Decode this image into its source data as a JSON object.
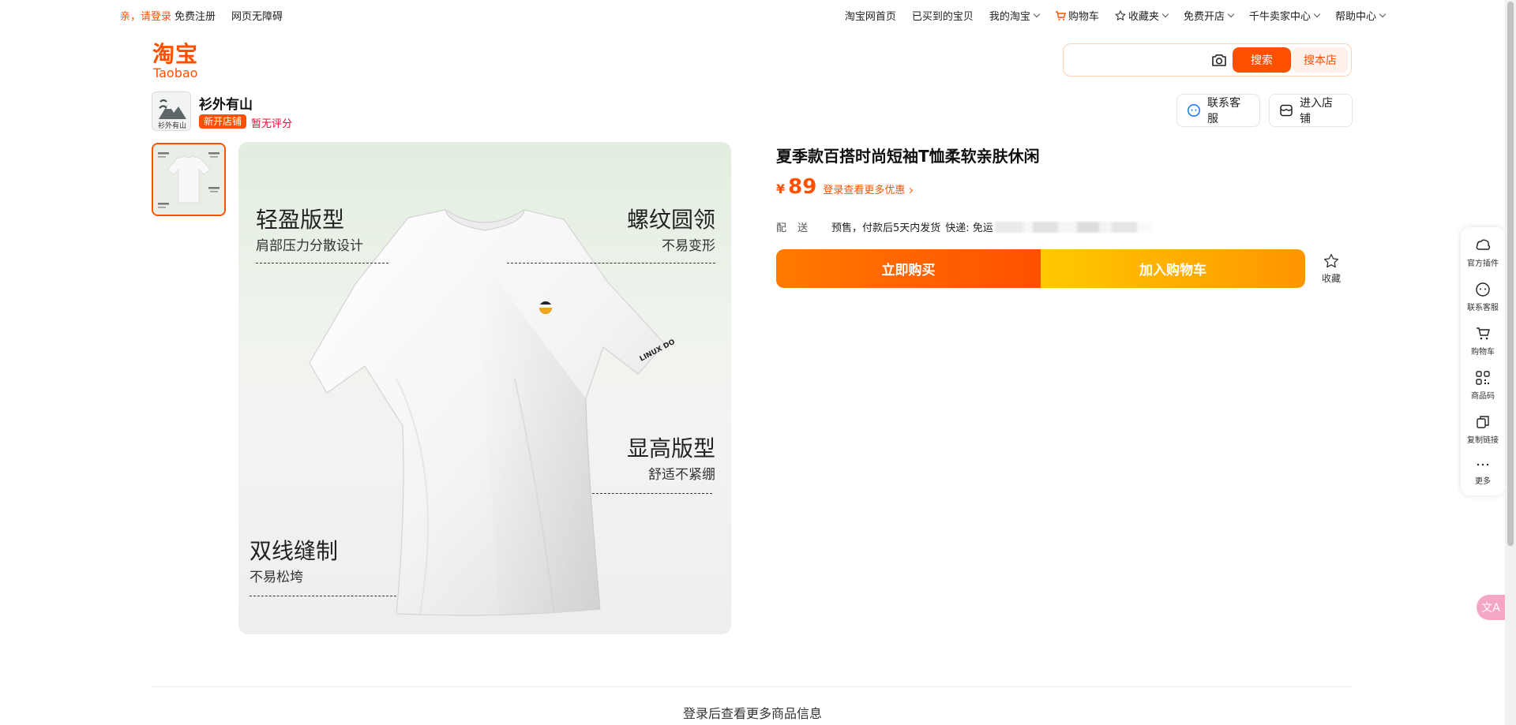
{
  "topbar": {
    "login": "亲，请登录",
    "register": "免费注册",
    "accessibility": "网页无障碍",
    "nav": [
      {
        "label": "淘宝网首页"
      },
      {
        "label": "已买到的宝贝"
      },
      {
        "label": "我的淘宝"
      },
      {
        "label": "购物车"
      },
      {
        "label": "收藏夹"
      },
      {
        "label": "免费开店"
      },
      {
        "label": "千牛卖家中心"
      },
      {
        "label": "帮助中心"
      }
    ]
  },
  "header": {
    "logo_cn": "淘宝",
    "logo_en": "Taobao",
    "search": {
      "placeholder": "",
      "search_button": "搜索",
      "store_button": "搜本店"
    }
  },
  "store": {
    "name": "衫外有山",
    "tag": "新开店铺",
    "rating": "暂无评分",
    "service_button": "联系客服",
    "enter_button": "进入店铺",
    "avatar_text": "衫外有山"
  },
  "gallery": {
    "features": [
      {
        "title": "轻盈版型",
        "subtitle": "肩部压力分散设计"
      },
      {
        "title": "螺纹圆领",
        "subtitle": "不易变形"
      },
      {
        "title": "显高版型",
        "subtitle": "舒适不紧绷"
      },
      {
        "title": "双线缝制",
        "subtitle": "不易松垮"
      }
    ],
    "sleeve_print": "LINUX DO"
  },
  "product": {
    "title": "夏季款百搭时尚短袖T恤柔软亲肤休闲",
    "currency": "¥",
    "price": "89",
    "price_more": "登录查看更多优惠",
    "shipping_label": "配送",
    "shipping_value": "预售，付款后5天内发货",
    "express": "快递: 免运",
    "buy_button": "立即购买",
    "cart_button": "加入购物车",
    "favorite": "收藏"
  },
  "sidebar": {
    "items": [
      {
        "label": "官方插件",
        "icon": "cloud-icon"
      },
      {
        "label": "联系客服",
        "icon": "chat-icon"
      },
      {
        "label": "购物车",
        "icon": "cart-icon"
      },
      {
        "label": "商品码",
        "icon": "qr-icon"
      },
      {
        "label": "复制链接",
        "icon": "copy-icon"
      },
      {
        "label": "更多",
        "icon": "more-icon"
      }
    ],
    "translate_label": "文A"
  },
  "footer": {
    "more_info": "登录后查看更多商品信息"
  },
  "colors": {
    "brand": "#ff5000",
    "cart_gradient_start": "#ffc900",
    "cart_gradient_end": "#ff9500",
    "rating": "#ff0036"
  }
}
